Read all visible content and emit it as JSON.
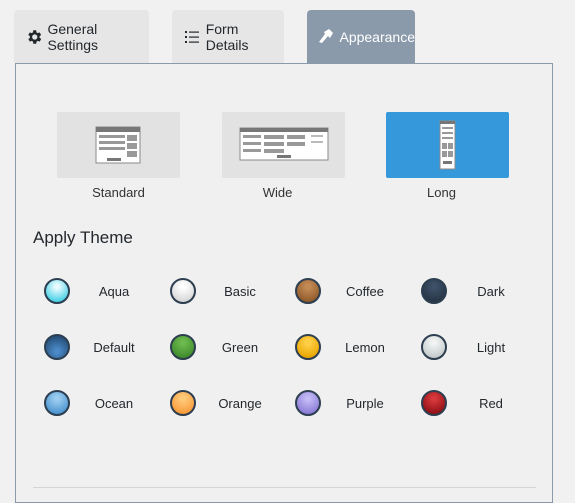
{
  "tabs": [
    {
      "label": "General Settings",
      "icon": "gear-icon"
    },
    {
      "label": "Form Details",
      "icon": "list-icon"
    },
    {
      "label": "Appearance",
      "icon": "paint-brush-icon",
      "active": true
    }
  ],
  "layouts": [
    {
      "label": "Standard",
      "selected": false
    },
    {
      "label": "Wide",
      "selected": false
    },
    {
      "label": "Long",
      "selected": true
    }
  ],
  "theme_section": {
    "heading": "Apply Theme"
  },
  "themes": [
    {
      "name": "Aqua",
      "color": "#4fd3e6"
    },
    {
      "name": "Basic",
      "color": "#e8e8e8"
    },
    {
      "name": "Coffee",
      "color": "#a56a35"
    },
    {
      "name": "Dark",
      "color": "#2d3e50"
    },
    {
      "name": "Default",
      "color": "#2f5f94"
    },
    {
      "name": "Green",
      "color": "#4b9a35"
    },
    {
      "name": "Lemon",
      "color": "#f2b20f"
    },
    {
      "name": "Light",
      "color": "#d9dddd"
    },
    {
      "name": "Ocean",
      "color": "#5aa2d8"
    },
    {
      "name": "Orange",
      "color": "#fca84b"
    },
    {
      "name": "Purple",
      "color": "#9b8de0"
    },
    {
      "name": "Red",
      "color": "#a8171c"
    }
  ],
  "colors": {
    "active_tab": "#8a9aab",
    "selected_layout": "#3498db"
  }
}
